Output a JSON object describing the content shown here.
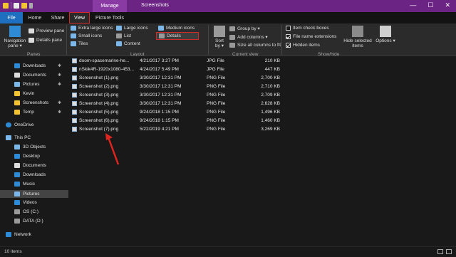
{
  "titlebar": {
    "manage_label": "Manage",
    "window_title": "Screenshots",
    "minimize": "—",
    "maximize": "☐",
    "close": "✕"
  },
  "tabs": [
    "File",
    "Home",
    "Share",
    "View",
    "Picture Tools"
  ],
  "ribbon": {
    "panes": {
      "navigation_pane": "Navigation pane ▾",
      "preview_pane": "Preview pane",
      "details_pane": "Details pane",
      "group_label": "Panes"
    },
    "layout": {
      "extra_large_icons": "Extra large icons",
      "large_icons": "Large icons",
      "medium_icons": "Medium icons",
      "small_icons": "Small icons",
      "list": "List",
      "details": "Details",
      "tiles": "Tiles",
      "content": "Content",
      "group_label": "Layout"
    },
    "current_view": {
      "sort_by": "Sort by ▾",
      "group_by": "Group by ▾",
      "add_columns": "Add columns ▾",
      "size_all_columns": "Size all columns to fit",
      "group_label": "Current view"
    },
    "show_hide": {
      "item_check_boxes": "Item check boxes",
      "file_name_extensions": "File name extensions",
      "hidden_items": "Hidden items",
      "hide_selected_items": "Hide selected items",
      "options": "Options ▾",
      "group_label": "Show/hide",
      "checks": {
        "item_check_boxes": false,
        "file_name_extensions": true,
        "hidden_items": true
      }
    }
  },
  "nav": {
    "quick_access": [
      {
        "label": "Downloads",
        "icon": "download-icon",
        "pinned": true
      },
      {
        "label": "Documents",
        "icon": "document-icon",
        "pinned": true
      },
      {
        "label": "Pictures",
        "icon": "pictures-icon",
        "pinned": true
      },
      {
        "label": "Kevin",
        "icon": "folder-icon",
        "pinned": false
      },
      {
        "label": "Screenshots",
        "icon": "folder-icon",
        "pinned": true
      },
      {
        "label": "Temp",
        "icon": "folder-icon",
        "pinned": true
      }
    ],
    "onedrive": "OneDrive",
    "this_pc": "This PC",
    "pc_items": [
      {
        "label": "3D Objects",
        "icon": "cube-icon"
      },
      {
        "label": "Desktop",
        "icon": "desktop-icon"
      },
      {
        "label": "Documents",
        "icon": "document-icon"
      },
      {
        "label": "Downloads",
        "icon": "download-icon"
      },
      {
        "label": "Music",
        "icon": "music-icon"
      },
      {
        "label": "Pictures",
        "icon": "pictures-icon"
      },
      {
        "label": "Videos",
        "icon": "video-icon"
      },
      {
        "label": "OS (C:)",
        "icon": "drive-icon"
      },
      {
        "label": "DATA (D:)",
        "icon": "drive-icon"
      }
    ],
    "network": "Network",
    "pin_glyph": "✱"
  },
  "files": [
    {
      "name": "doom-spacemarine-he...",
      "date": "4/21/2017 3:27 PM",
      "type": "JPG File",
      "size": "210 KB"
    },
    {
      "name": "nSkik4R-1920x1080-453...",
      "date": "4/24/2017 5:49 PM",
      "type": "JPG File",
      "size": "447 KB"
    },
    {
      "name": "Screenshot (1).png",
      "date": "3/30/2017 12:31 PM",
      "type": "PNG File",
      "size": "2,700 KB"
    },
    {
      "name": "Screenshot (2).png",
      "date": "3/30/2017 12:31 PM",
      "type": "PNG File",
      "size": "2,710 KB"
    },
    {
      "name": "Screenshot (3).png",
      "date": "3/30/2017 12:31 PM",
      "type": "PNG File",
      "size": "2,709 KB"
    },
    {
      "name": "Screenshot (4).png",
      "date": "3/30/2017 12:31 PM",
      "type": "PNG File",
      "size": "2,628 KB"
    },
    {
      "name": "Screenshot (5).png",
      "date": "9/24/2018 1:15 PM",
      "type": "PNG File",
      "size": "1,496 KB"
    },
    {
      "name": "Screenshot (6).png",
      "date": "9/24/2018 1:15 PM",
      "type": "PNG File",
      "size": "1,460 KB"
    },
    {
      "name": "Screenshot (7).png",
      "date": "5/22/2019 4:21 PM",
      "type": "PNG File",
      "size": "3,269 KB"
    }
  ],
  "status": {
    "items": "10 items"
  },
  "colors": {
    "accent_purple": "#6b2484",
    "file_tab_blue": "#1f6fc0",
    "highlight_red": "#d42a2a"
  }
}
